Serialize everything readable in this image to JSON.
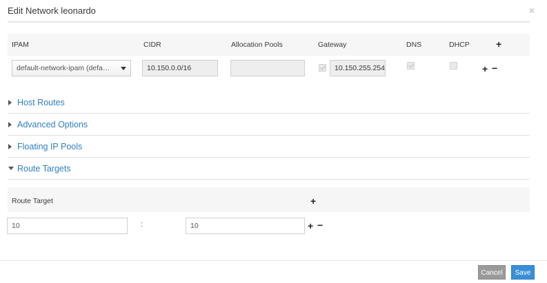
{
  "modal": {
    "title": "Edit Network leonardo",
    "close_label": "×"
  },
  "ipam_table": {
    "headers": {
      "ipam": "IPAM",
      "cidr": "CIDR",
      "allocation_pools": "Allocation Pools",
      "gateway": "Gateway",
      "dns": "DNS",
      "dhcp": "DHCP"
    },
    "row": {
      "ipam_value": "default-network-ipam (defa…",
      "cidr_value": "10.150.0.0/16",
      "allocation_pools_value": "",
      "gateway_checked": true,
      "gateway_value": "10.150.255.254",
      "dns_checked": true,
      "dhcp_checked": false
    }
  },
  "sections": {
    "host_routes": "Host Routes",
    "advanced_options": "Advanced Options",
    "floating_ip_pools": "Floating IP Pools",
    "route_targets": "Route Targets"
  },
  "route_targets": {
    "header": "Route Target",
    "separator": ":",
    "row": {
      "asn": "10",
      "target": "10"
    }
  },
  "icons": {
    "plus": "+",
    "minus": "−"
  },
  "footer": {
    "cancel_label": "Cancel",
    "save_label": "Save"
  },
  "colors": {
    "link": "#2f7ec3",
    "save": "#3a8fd7",
    "cancel": "#9a9a9a"
  }
}
